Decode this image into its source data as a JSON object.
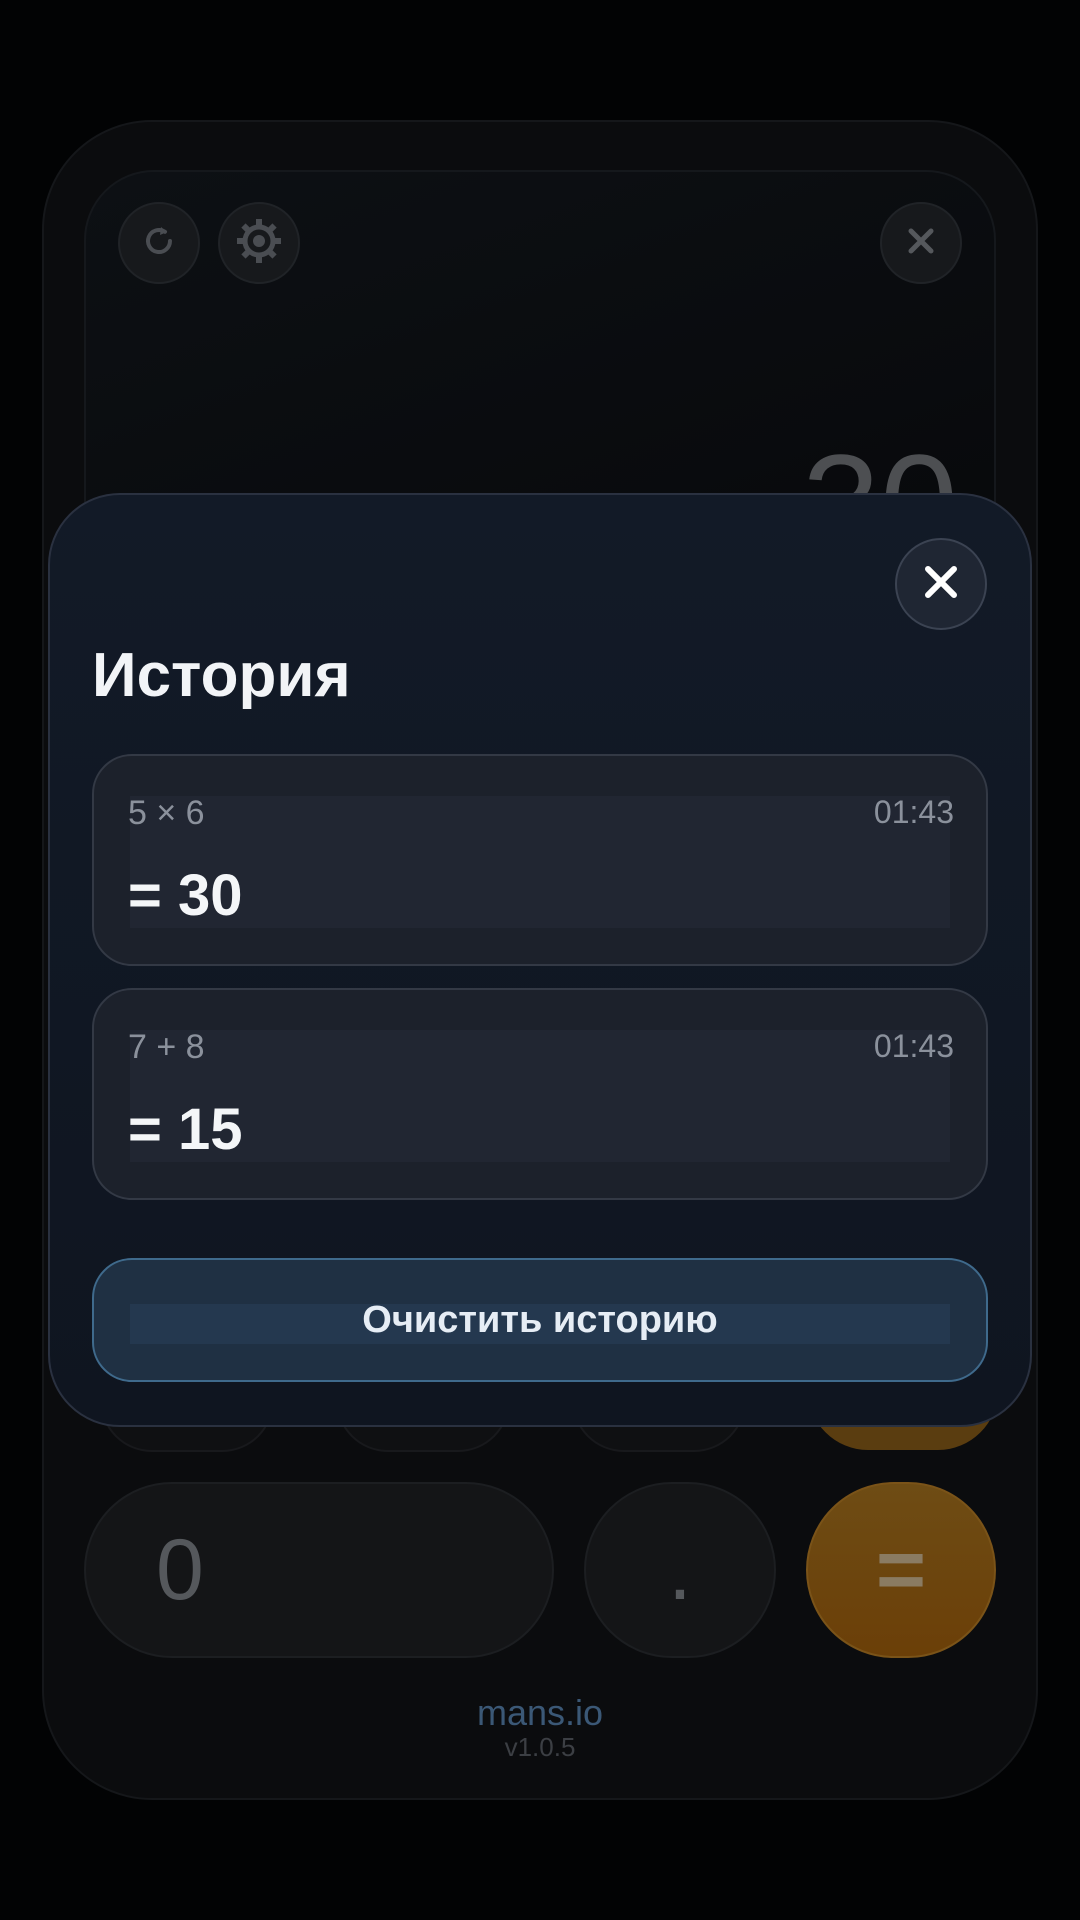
{
  "calculator": {
    "display_value": "30",
    "keys": {
      "zero": "0",
      "dot": ".",
      "equals": "="
    },
    "icons": {
      "history": "history-icon",
      "settings": "gear-icon",
      "close": "close-icon"
    }
  },
  "history_sheet": {
    "title": "История",
    "close_icon": "close-icon",
    "entries": [
      {
        "expression": "5 × 6",
        "time": "01:43",
        "result": "= 30"
      },
      {
        "expression": "7 + 8",
        "time": "01:43",
        "result": "= 15"
      }
    ],
    "clear_label": "Очистить историю"
  },
  "footer": {
    "brand": "mans.io",
    "version": "v1.0.5"
  },
  "colors": {
    "accent_orange": "#6b3f08",
    "sheet_bg": "#121a27",
    "clear_button_border": "#3f6a8c"
  }
}
